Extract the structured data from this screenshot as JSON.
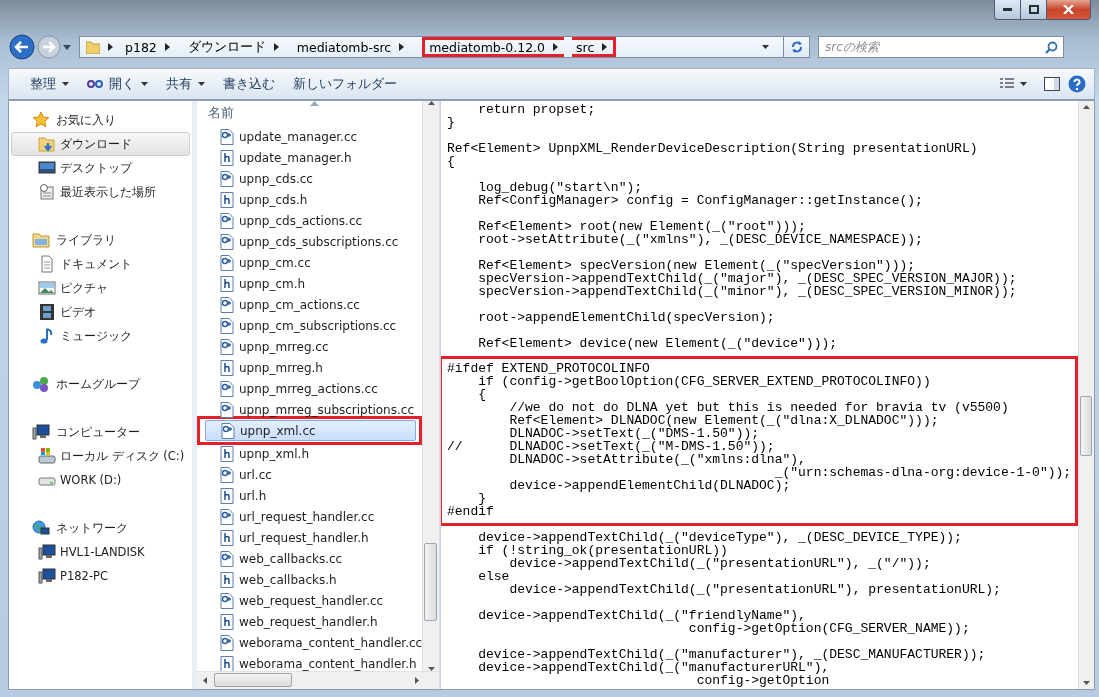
{
  "address_bar": {
    "breadcrumbs": [
      {
        "label": "p182",
        "annotated": false
      },
      {
        "label": "ダウンロード",
        "annotated": false
      },
      {
        "label": "mediatomb-src",
        "annotated": false
      },
      {
        "label": "mediatomb-0.12.0",
        "annotated": true
      },
      {
        "label": "src",
        "annotated": true
      }
    ],
    "search": {
      "placeholder": "srcの検索"
    }
  },
  "toolbar": {
    "buttons": [
      {
        "label": "整理",
        "kind": "menu"
      },
      {
        "label": "開く",
        "kind": "open-menu"
      },
      {
        "label": "共有",
        "kind": "menu"
      },
      {
        "label": "書き込む",
        "kind": "plain"
      },
      {
        "label": "新しいフォルダー",
        "kind": "plain"
      }
    ]
  },
  "navigation": {
    "groups": [
      {
        "label": "お気に入り",
        "kind": "favorites",
        "selected": false,
        "children": [
          {
            "label": "ダウンロード",
            "kind": "downloads",
            "selected": true
          },
          {
            "label": "デスクトップ",
            "kind": "desktop",
            "selected": false
          },
          {
            "label": "最近表示した場所",
            "kind": "recent",
            "selected": false
          }
        ]
      },
      {
        "label": "ライブラリ",
        "kind": "libraries",
        "selected": false,
        "children": [
          {
            "label": "ドキュメント",
            "kind": "documents",
            "selected": false
          },
          {
            "label": "ピクチャ",
            "kind": "pictures",
            "selected": false
          },
          {
            "label": "ビデオ",
            "kind": "videos",
            "selected": false
          },
          {
            "label": "ミュージック",
            "kind": "music",
            "selected": false
          }
        ]
      },
      {
        "label": "ホームグループ",
        "kind": "homegroup",
        "selected": false
      },
      {
        "label": "コンピューター",
        "kind": "computer",
        "selected": false,
        "children": [
          {
            "label": "ローカル ディスク (C:)",
            "kind": "system-drive",
            "selected": false
          },
          {
            "label": "WORK (D:)",
            "kind": "drive",
            "selected": false
          }
        ]
      },
      {
        "label": "ネットワーク",
        "kind": "network",
        "selected": false,
        "children": [
          {
            "label": "HVL1-LANDISK",
            "kind": "computer",
            "selected": false
          },
          {
            "label": "P182-PC",
            "kind": "computer",
            "selected": false
          }
        ]
      }
    ]
  },
  "file_list": {
    "column": "名前",
    "files": [
      {
        "name": "update_manager.cc",
        "kind": "cpp",
        "selected": false,
        "annotated": false
      },
      {
        "name": "update_manager.h",
        "kind": "header",
        "selected": false,
        "annotated": false
      },
      {
        "name": "upnp_cds.cc",
        "kind": "cpp",
        "selected": false,
        "annotated": false
      },
      {
        "name": "upnp_cds.h",
        "kind": "header",
        "selected": false,
        "annotated": false
      },
      {
        "name": "upnp_cds_actions.cc",
        "kind": "cpp",
        "selected": false,
        "annotated": false
      },
      {
        "name": "upnp_cds_subscriptions.cc",
        "kind": "cpp",
        "selected": false,
        "annotated": false
      },
      {
        "name": "upnp_cm.cc",
        "kind": "cpp",
        "selected": false,
        "annotated": false
      },
      {
        "name": "upnp_cm.h",
        "kind": "header",
        "selected": false,
        "annotated": false
      },
      {
        "name": "upnp_cm_actions.cc",
        "kind": "cpp",
        "selected": false,
        "annotated": false
      },
      {
        "name": "upnp_cm_subscriptions.cc",
        "kind": "cpp",
        "selected": false,
        "annotated": false
      },
      {
        "name": "upnp_mrreg.cc",
        "kind": "cpp",
        "selected": false,
        "annotated": false
      },
      {
        "name": "upnp_mrreg.h",
        "kind": "header",
        "selected": false,
        "annotated": false
      },
      {
        "name": "upnp_mrreg_actions.cc",
        "kind": "cpp",
        "selected": false,
        "annotated": false
      },
      {
        "name": "upnp_mrreg_subscriptions.cc",
        "kind": "cpp",
        "selected": false,
        "annotated": false
      },
      {
        "name": "upnp_xml.cc",
        "kind": "cpp",
        "selected": true,
        "annotated": true
      },
      {
        "name": "upnp_xml.h",
        "kind": "header",
        "selected": false,
        "annotated": false
      },
      {
        "name": "url.cc",
        "kind": "cpp",
        "selected": false,
        "annotated": false
      },
      {
        "name": "url.h",
        "kind": "header",
        "selected": false,
        "annotated": false
      },
      {
        "name": "url_request_handler.cc",
        "kind": "cpp",
        "selected": false,
        "annotated": false
      },
      {
        "name": "url_request_handler.h",
        "kind": "header",
        "selected": false,
        "annotated": false
      },
      {
        "name": "web_callbacks.cc",
        "kind": "cpp",
        "selected": false,
        "annotated": false
      },
      {
        "name": "web_callbacks.h",
        "kind": "header",
        "selected": false,
        "annotated": false
      },
      {
        "name": "web_request_handler.cc",
        "kind": "cpp",
        "selected": false,
        "annotated": false
      },
      {
        "name": "web_request_handler.h",
        "kind": "header",
        "selected": false,
        "annotated": false
      },
      {
        "name": "weborama_content_handler.cc",
        "kind": "cpp",
        "selected": false,
        "annotated": false
      },
      {
        "name": "weborama_content_handler.h",
        "kind": "header",
        "selected": false,
        "annotated": false
      }
    ]
  },
  "preview": {
    "blocks": [
      {
        "annotated": false,
        "lines": [
          "    return propset;",
          "}"
        ]
      },
      {
        "annotated": false,
        "lines": [
          "Ref<Element> UpnpXML_RenderDeviceDescription(String presentationURL)",
          "{"
        ]
      },
      {
        "annotated": false,
        "lines": [
          "    log_debug(\"start\\n\");",
          "    Ref<ConfigManager> config = ConfigManager::getInstance();"
        ]
      },
      {
        "annotated": false,
        "lines": [
          "    Ref<Element> root(new Element(_(\"root\")));",
          "    root->setAttribute(_(\"xmlns\"), _(DESC_DEVICE_NAMESPACE));"
        ]
      },
      {
        "annotated": false,
        "lines": [
          "    Ref<Element> specVersion(new Element(_(\"specVersion\")));",
          "    specVersion->appendTextChild(_(\"major\"), _(DESC_SPEC_VERSION_MAJOR));",
          "    specVersion->appendTextChild(_(\"minor\"), _(DESC_SPEC_VERSION_MINOR));"
        ]
      },
      {
        "annotated": false,
        "lines": [
          "    root->appendElementChild(specVersion);"
        ]
      },
      {
        "annotated": false,
        "lines": [
          "    Ref<Element> device(new Element(_(\"device\")));"
        ]
      },
      {
        "annotated": true,
        "lines": [
          "#ifdef EXTEND_PROTOCOLINFO",
          "    if (config->getBoolOption(CFG_SERVER_EXTEND_PROTOCOLINFO))",
          "    {",
          "        //we do not do DLNA yet but this is needed for bravia tv (v5500)",
          "        Ref<Element> DLNADOC(new Element(_(\"dlna:X_DLNADOC\")));",
          "        DLNADOC->setText(_(\"DMS-1.50\"));",
          "//      DLNADOC->setText(_(\"M-DMS-1.50\"));",
          "        DLNADOC->setAttribute(_(\"xmlns:dlna\"),",
          "                                          _(\"urn:schemas-dlna-org:device-1-0\"));",
          "        device->appendElementChild(DLNADOC);",
          "    }",
          "#endif"
        ]
      },
      {
        "annotated": false,
        "lines": [
          "    device->appendTextChild(_(\"deviceType\"), _(DESC_DEVICE_TYPE));",
          "    if (!string_ok(presentationURL))",
          "        device->appendTextChild(_(\"presentationURL\"), _(\"/\"));",
          "    else",
          "        device->appendTextChild(_(\"presentationURL\"), presentationURL);"
        ]
      },
      {
        "annotated": false,
        "lines": [
          "    device->appendTextChild(_(\"friendlyName\"),",
          "                               config->getOption(CFG_SERVER_NAME));"
        ]
      },
      {
        "annotated": false,
        "lines": [
          "    device->appendTextChild(_(\"manufacturer\"), _(DESC_MANUFACTURER));",
          "    device->appendTextChild(_(\"manufacturerURL\"),",
          "                                config->getOption"
        ]
      }
    ]
  }
}
